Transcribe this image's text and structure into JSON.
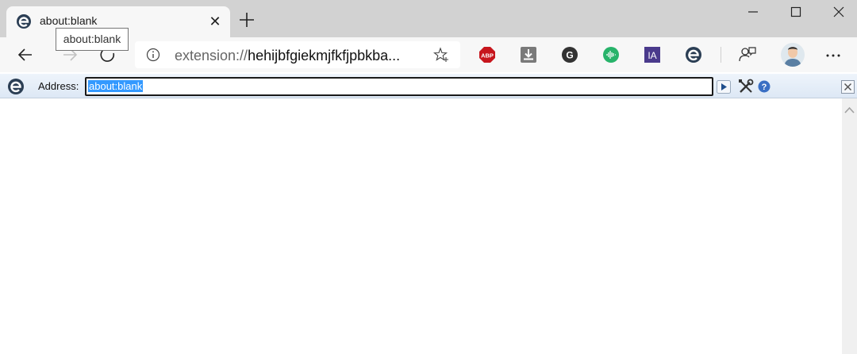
{
  "tab": {
    "title": "about:blank",
    "close_glyph": "✕"
  },
  "tooltip": {
    "text": "about:blank"
  },
  "omnibox": {
    "scheme": "extension://",
    "host": "hehijbfgiekmjfkfjpbkba..."
  },
  "iebar": {
    "address_label": "Address:",
    "address_value": "about:blank"
  },
  "icons": {
    "favicon": "ie-tab-icon",
    "new_tab": "plus-icon",
    "back": "back-arrow-icon",
    "forward": "forward-arrow-icon",
    "refresh": "refresh-icon",
    "info": "info-icon",
    "favorite": "star-plus-icon",
    "extensions": [
      "adblock-plus-icon",
      "download-icon",
      "grammarly-icon",
      "sound-icon",
      "ia-icon",
      "ie-tab-icon"
    ],
    "feedback": "feedback-icon",
    "more": "more-icon"
  },
  "colors": {
    "tabstrip": "#d2d2d2",
    "toolbar": "#f7f7f7",
    "selection": "#3399ff",
    "abp_red": "#c7161d",
    "green_ext": "#27b36a",
    "ia_purple": "#4a3a8c"
  }
}
